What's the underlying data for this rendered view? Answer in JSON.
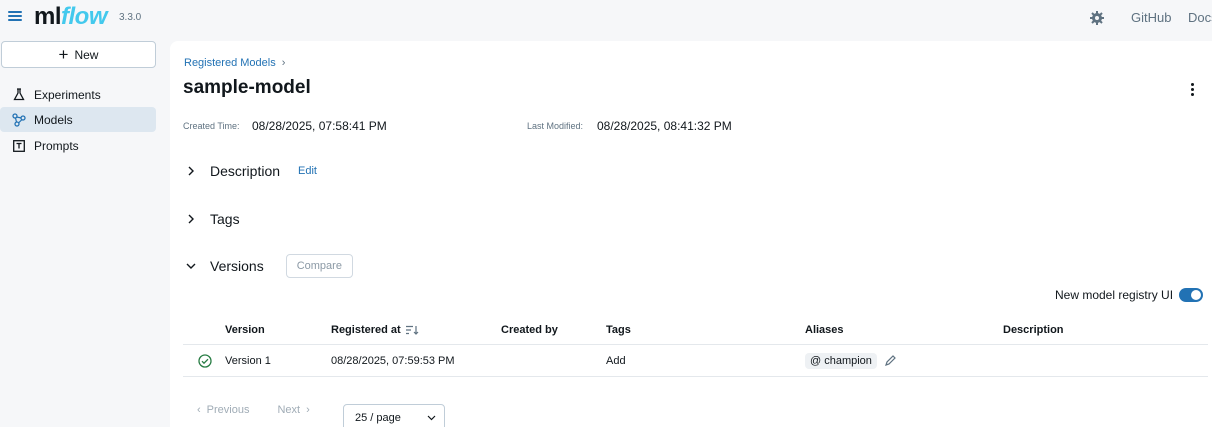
{
  "header": {
    "logo_ml": "ml",
    "logo_flow": "flow",
    "version": "3.3.0",
    "links": [
      "GitHub",
      "Docs"
    ]
  },
  "sidebar": {
    "new_label": "New",
    "items": [
      {
        "label": "Experiments",
        "icon": "beaker-icon",
        "active": false
      },
      {
        "label": "Models",
        "icon": "models-icon",
        "active": true
      },
      {
        "label": "Prompts",
        "icon": "prompt-icon",
        "active": false
      }
    ]
  },
  "main": {
    "breadcrumb": "Registered Models",
    "title": "sample-model",
    "created_label": "Created Time:",
    "created_value": "08/28/2025, 07:58:41 PM",
    "modified_label": "Last Modified:",
    "modified_value": "08/28/2025, 08:41:32 PM",
    "sections": {
      "description": "Description",
      "edit": "Edit",
      "tags": "Tags",
      "versions": "Versions",
      "compare": "Compare"
    },
    "toggle_label": "New model registry UI",
    "toggle_on": true,
    "table": {
      "headers": [
        "Version",
        "Registered at",
        "Created by",
        "Tags",
        "Aliases",
        "Description"
      ],
      "rows": [
        {
          "status": "ready",
          "version": "Version 1",
          "registered_at": "08/28/2025, 07:59:53 PM",
          "created_by": "",
          "tags_action": "Add",
          "alias": "@ champion",
          "description": ""
        }
      ]
    },
    "pagination": {
      "previous": "Previous",
      "next": "Next",
      "page_size": "25 / page"
    }
  },
  "colors": {
    "accent": "#2272b4",
    "logo_flow": "#43c9ed",
    "active_nav": "#dde7f0",
    "success": "#277c43"
  }
}
